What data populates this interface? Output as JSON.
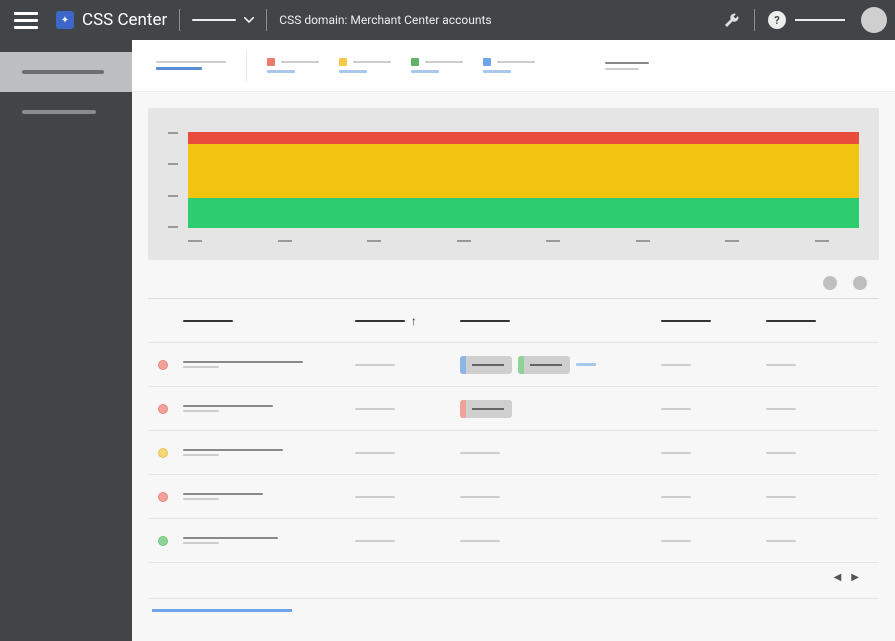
{
  "header": {
    "app_title": "CSS Center",
    "breadcrumb": "CSS domain: Merchant Center accounts",
    "logo_glyph": "✦"
  },
  "sidebar": {
    "items": [
      {
        "label": "placeholder-nav-1",
        "active": true
      },
      {
        "label": "placeholder-nav-2",
        "active": false
      }
    ]
  },
  "filter": {
    "title_line1": "placeholder",
    "title_line2": "placeholder",
    "legends": [
      {
        "color": "red",
        "label": "placeholder",
        "value": "placeholder"
      },
      {
        "color": "yellow",
        "label": "placeholder",
        "value": "placeholder"
      },
      {
        "color": "green",
        "label": "placeholder",
        "value": "placeholder"
      },
      {
        "color": "blue",
        "label": "placeholder",
        "value": "placeholder"
      }
    ],
    "trailing": "placeholder"
  },
  "chart_data": {
    "type": "bar",
    "title": "",
    "xlabel": "",
    "ylabel": "",
    "categories": [
      "",
      "",
      "",
      "",
      "",
      "",
      "",
      ""
    ],
    "series": [
      {
        "name": "red",
        "color": "#e74c3c",
        "values": [
          12,
          12,
          12,
          12,
          12,
          12,
          12,
          12
        ]
      },
      {
        "name": "yellow",
        "color": "#f1c40f",
        "values": [
          54,
          54,
          54,
          54,
          54,
          54,
          54,
          54
        ]
      },
      {
        "name": "green",
        "color": "#2ecc71",
        "values": [
          30,
          30,
          30,
          30,
          30,
          30,
          30,
          30
        ]
      }
    ],
    "y_ticks": [
      "",
      "",
      "",
      ""
    ],
    "ylim": [
      0,
      100
    ]
  },
  "table": {
    "columns": [
      "col1",
      "col2",
      "col3",
      "col4",
      "col5"
    ],
    "sort_column_index": 1,
    "sort_dir": "asc",
    "rows": [
      {
        "status": "red",
        "name": "placeholder",
        "sub": "placeholder",
        "c2": "placeholder",
        "chips": [
          "blue",
          "green"
        ],
        "extra": "placeholder",
        "c4": "placeholder",
        "c5": "placeholder"
      },
      {
        "status": "red",
        "name": "placeholder",
        "sub": "placeholder",
        "c2": "placeholder",
        "chips": [
          "red"
        ],
        "c4": "placeholder",
        "c5": "placeholder"
      },
      {
        "status": "yellow",
        "name": "placeholder",
        "sub": "placeholder",
        "c2": "placeholder",
        "chips": [],
        "c4": "placeholder",
        "c5": "placeholder"
      },
      {
        "status": "red",
        "name": "placeholder",
        "sub": "placeholder",
        "c2": "placeholder",
        "chips": [],
        "c4": "placeholder",
        "c5": "placeholder"
      },
      {
        "status": "green",
        "name": "placeholder",
        "sub": "placeholder",
        "c2": "placeholder",
        "chips": [],
        "c4": "placeholder",
        "c5": "placeholder"
      }
    ]
  },
  "footer_link": "placeholder"
}
